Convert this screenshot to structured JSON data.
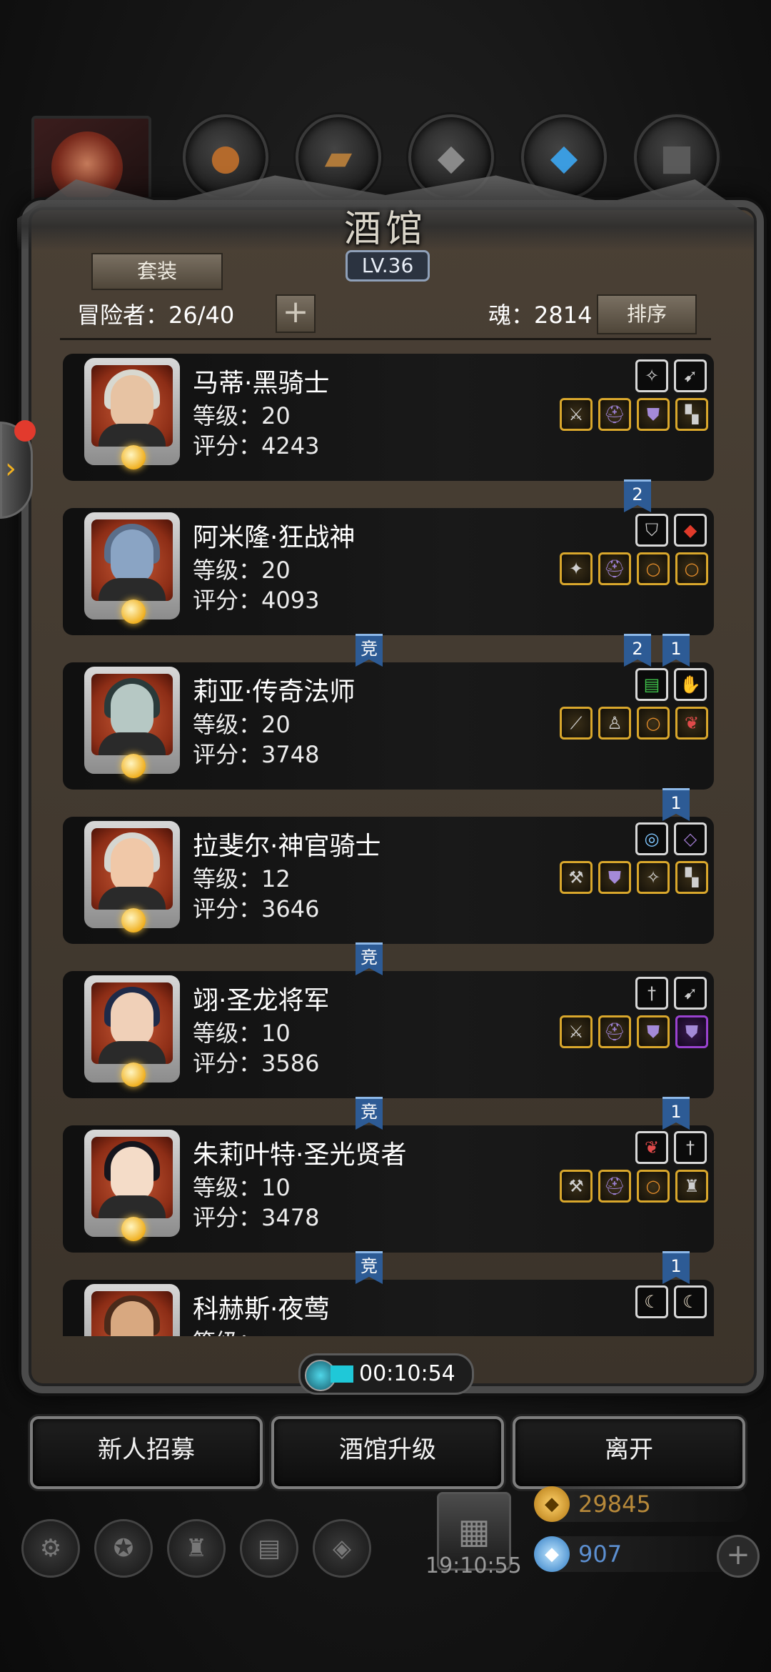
{
  "title": "酒馆",
  "level": "LV.36",
  "suit_button": "套装",
  "adventurers_label": "冒险者：26/40",
  "add_button": "+",
  "soul_label": "魂：2814",
  "sort_button": "排序",
  "top_tabs": [
    {
      "icon": "hero-portrait-icon"
    },
    {
      "icon": "leather-pouch-icon"
    },
    {
      "icon": "wood-planks-icon"
    },
    {
      "icon": "iron-ore-icon"
    },
    {
      "icon": "blue-crystal-icon"
    },
    {
      "icon": "dark-ore-icon"
    }
  ],
  "heroes": [
    {
      "name": "马蒂·黑骑士",
      "level": "等级：20",
      "score": "评分：4243",
      "top_slots": [
        "amulet-icon",
        "bow-icon"
      ],
      "bottom_slots": [
        "sword-icon",
        "helmet-icon",
        "armor-icon",
        "boots-icon"
      ],
      "bottom_border": [
        "gold",
        "gold",
        "gold",
        "gold"
      ]
    },
    {
      "name": "阿米隆·狂战神",
      "level": "等级：20",
      "score": "评分：4093",
      "top_slots": [
        "shield-icon",
        "gem-icon"
      ],
      "bottom_slots": [
        "mace-icon",
        "helmet-icon",
        "ring-icon",
        "ring-icon"
      ],
      "bottom_border": [
        "gold",
        "gold",
        "gold",
        "gold"
      ]
    },
    {
      "name": "莉亚·传奇法师",
      "level": "等级：20",
      "score": "评分：3748",
      "top_slots": [
        "book-icon",
        "glove-icon"
      ],
      "bottom_slots": [
        "staff-icon",
        "robe-icon",
        "ring-icon",
        "necklace-icon"
      ],
      "bottom_border": [
        "gold",
        "gold",
        "gold",
        "gold"
      ]
    },
    {
      "name": "拉斐尔·神官骑士",
      "level": "等级：12",
      "score": "评分：3646",
      "top_slots": [
        "bracelet-icon",
        "crystal-icon"
      ],
      "bottom_slots": [
        "axe-icon",
        "armor-icon",
        "amulet-icon",
        "boots-icon"
      ],
      "bottom_border": [
        "gold",
        "gold",
        "gold",
        "gold"
      ]
    },
    {
      "name": "翊·圣龙将军",
      "level": "等级：10",
      "score": "评分：3586",
      "top_slots": [
        "dagger-icon",
        "bow-icon"
      ],
      "bottom_slots": [
        "sword-icon",
        "helmet-icon",
        "armor-icon",
        "armor-icon"
      ],
      "bottom_border": [
        "gold",
        "gold",
        "gold",
        "purple"
      ]
    },
    {
      "name": "朱莉叶特·圣光贤者",
      "level": "等级：10",
      "score": "评分：3478",
      "top_slots": [
        "necklace-icon",
        "dagger-icon"
      ],
      "bottom_slots": [
        "hammer-icon",
        "helmet-icon",
        "ring-icon",
        "cloak-icon"
      ],
      "bottom_border": [
        "gold",
        "gold",
        "gold",
        "gold"
      ]
    },
    {
      "name": "科赫斯·夜莺",
      "level": "等级：",
      "score": "",
      "top_slots": [
        "claw-icon",
        "claw-icon"
      ],
      "bottom_slots": [],
      "bottom_border": []
    }
  ],
  "tags": [
    {
      "text": "2",
      "after": 0,
      "pos": "right-a"
    },
    {
      "text": "竞",
      "after": 1,
      "pos": "mid"
    },
    {
      "text": "2",
      "after": 1,
      "pos": "right-a"
    },
    {
      "text": "1",
      "after": 1,
      "pos": "right-b"
    },
    {
      "text": "1",
      "after": 2,
      "pos": "right-b"
    },
    {
      "text": "竞",
      "after": 3,
      "pos": "mid"
    },
    {
      "text": "竞",
      "after": 4,
      "pos": "mid"
    },
    {
      "text": "1",
      "after": 4,
      "pos": "right-b"
    },
    {
      "text": "竞",
      "after": 5,
      "pos": "mid"
    },
    {
      "text": "1",
      "after": 5,
      "pos": "right-b"
    }
  ],
  "timer": "00:10:54",
  "actions": {
    "recruit": "新人招募",
    "upgrade": "酒馆升级",
    "leave": "离开"
  },
  "bottom_nav": [
    "settings-icon",
    "badge-icon",
    "castle-icon",
    "map-icon",
    "cube-icon"
  ],
  "gift_timer": "19:10:55",
  "gold": "29845",
  "diamonds": "907",
  "colors": {
    "accent_blue": "#2d5b95",
    "gold": "#d9a72c",
    "frame": "#4a4035"
  }
}
